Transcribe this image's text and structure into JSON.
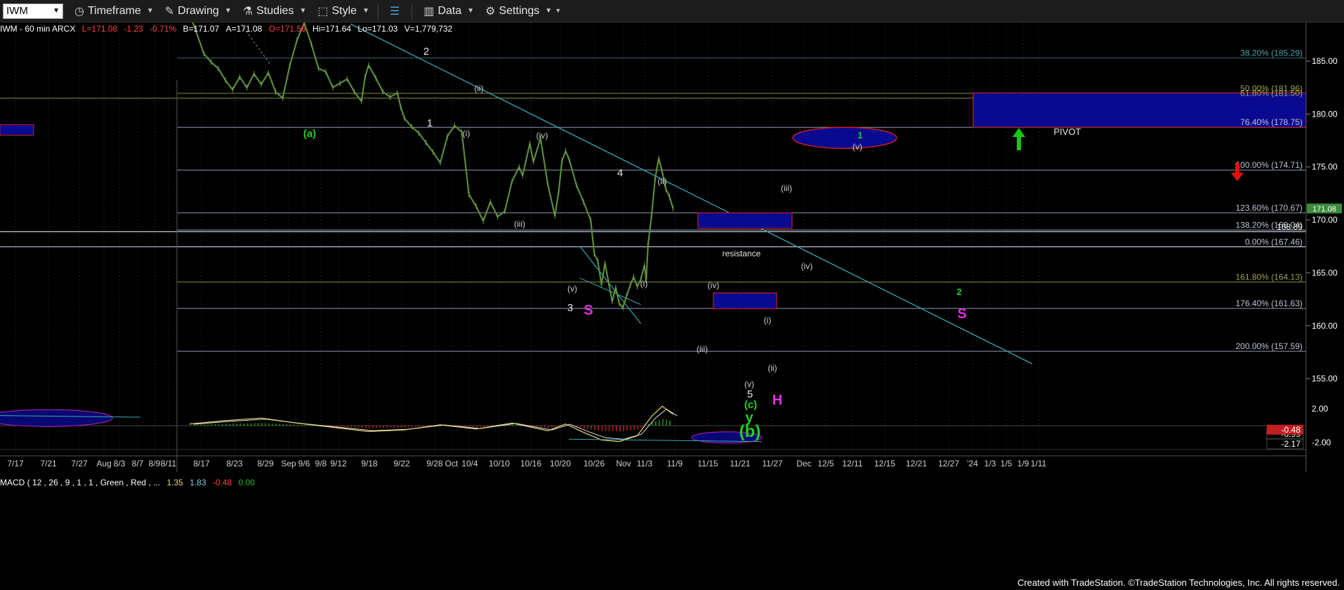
{
  "toolbar": {
    "symbol": "IWM",
    "timeframe": "Timeframe",
    "drawing": "Drawing",
    "studies": "Studies",
    "style": "Style",
    "data": "Data",
    "settings": "Settings"
  },
  "status": {
    "name": "IWM - 60 min  ARCX",
    "last": "L=171.08",
    "change": "-1.23",
    "change_pct": "-0.71%",
    "bid": "B=171.07",
    "ask": "A=171.08",
    "open": "O=171.56",
    "high": "Hi=171.64",
    "low": "Lo=171.03",
    "volume": "V=1,779,732"
  },
  "macd_status": {
    "name": "MACD ( 12 , 26 , 9 , 1 , 1 , Green , Red , ...",
    "v1": "1.35",
    "v2": "1.83",
    "v3": "-0.48",
    "v4": "0.00"
  },
  "credit": "Created with TradeStation. ©TradeStation Technologies, Inc. All rights reserved.",
  "colors": {
    "price": "#5a8a3c",
    "fib_line": "#8a9ab0",
    "trend_line": "#36a8b8",
    "box": "#0a0a90",
    "label_green": "#1ed01e",
    "label_magenta": "#e030e0",
    "pivot_arrow": "#14c814",
    "down_arrow": "#e01010",
    "macd_fast": "#e8d46a",
    "macd_slow": "#e0e0e0"
  },
  "chart_data": {
    "type": "line",
    "title": "IWM - 60 min",
    "y_axis": {
      "ticks": [
        "185.00",
        "180.00",
        "175.00",
        "170.00",
        "165.00",
        "160.00",
        "155.00"
      ],
      "ylim": [
        153.2,
        189.5
      ]
    },
    "x_axis": {
      "ticks": [
        "7/17",
        "7/21",
        "7/27",
        "Aug",
        "8/3",
        "8/7",
        "8/9",
        "8/11",
        "8/17",
        "8/23",
        "8/29",
        "Sep",
        "9/6",
        "9/8",
        "9/12",
        "9/18",
        "9/22",
        "9/28",
        "Oct",
        "10/4",
        "10/10",
        "10/16",
        "10/20",
        "10/26",
        "Nov",
        "11/3",
        "11/9",
        "11/15",
        "11/21",
        "11/27",
        "Dec",
        "12/5",
        "12/11",
        "12/15",
        "12/21",
        "12/27",
        "'24",
        "1/3",
        "1/5",
        "1/9",
        "1/11"
      ]
    },
    "last_price": "171.08",
    "level_tag": "168.89",
    "series": [
      {
        "name": "IWM",
        "points": [
          [
            0,
            189.5
          ],
          [
            8,
            185.7
          ],
          [
            12,
            184.9
          ],
          [
            16,
            184.3
          ],
          [
            20,
            183.2
          ],
          [
            24,
            182.3
          ],
          [
            28,
            183.5
          ],
          [
            32,
            182.5
          ],
          [
            36,
            183.8
          ],
          [
            40,
            182.8
          ],
          [
            44,
            183.9
          ],
          [
            48,
            182.1
          ],
          [
            52,
            181.5
          ],
          [
            56,
            184.6
          ],
          [
            60,
            187.0
          ],
          [
            64,
            188.6
          ],
          [
            68,
            186.6
          ],
          [
            72,
            184.3
          ],
          [
            76,
            184.0
          ],
          [
            80,
            182.5
          ],
          [
            84,
            182.9
          ],
          [
            88,
            183.3
          ],
          [
            92,
            182.1
          ],
          [
            96,
            181.2
          ],
          [
            98,
            183.5
          ],
          [
            100,
            184.6
          ],
          [
            104,
            183.4
          ],
          [
            108,
            182.1
          ],
          [
            112,
            181.6
          ],
          [
            116,
            182.0
          ],
          [
            118,
            180.6
          ],
          [
            120,
            179.6
          ],
          [
            124,
            178.8
          ],
          [
            128,
            178.2
          ],
          [
            132,
            177.3
          ],
          [
            136,
            176.4
          ],
          [
            140,
            175.4
          ],
          [
            144,
            177.9
          ],
          [
            148,
            178.9
          ],
          [
            152,
            178.3
          ],
          [
            156,
            172.4
          ],
          [
            160,
            171.3
          ],
          [
            164,
            169.9
          ],
          [
            168,
            171.7
          ],
          [
            172,
            170.3
          ],
          [
            176,
            170.8
          ],
          [
            180,
            173.6
          ],
          [
            184,
            175.0
          ],
          [
            186,
            174.2
          ],
          [
            190,
            177.2
          ],
          [
            192,
            175.5
          ],
          [
            196,
            177.7
          ],
          [
            200,
            173.4
          ],
          [
            204,
            170.4
          ],
          [
            206,
            172.5
          ],
          [
            208,
            175.6
          ],
          [
            210,
            176.5
          ],
          [
            212,
            175.7
          ],
          [
            216,
            173.3
          ],
          [
            220,
            171.7
          ],
          [
            224,
            170.0
          ],
          [
            226,
            166.8
          ],
          [
            228,
            166.1
          ],
          [
            230,
            163.9
          ],
          [
            232,
            165.9
          ],
          [
            234,
            164.1
          ],
          [
            236,
            162.3
          ],
          [
            238,
            163.6
          ],
          [
            240,
            162.1
          ],
          [
            242,
            161.7
          ],
          [
            244,
            162.8
          ],
          [
            246,
            163.8
          ],
          [
            248,
            164.6
          ],
          [
            250,
            163.7
          ],
          [
            252,
            164.4
          ],
          [
            254,
            165.7
          ],
          [
            255,
            164.3
          ],
          [
            256,
            167.6
          ],
          [
            258,
            170.4
          ],
          [
            260,
            173.9
          ],
          [
            262,
            175.8
          ],
          [
            264,
            174.5
          ],
          [
            266,
            172.9
          ],
          [
            268,
            172.2
          ],
          [
            270,
            171.08
          ]
        ]
      },
      {
        "name": "MACD",
        "points": [
          [
            0,
            0.2
          ],
          [
            20,
            0.6
          ],
          [
            40,
            0.9
          ],
          [
            60,
            0.3
          ],
          [
            80,
            -0.2
          ],
          [
            100,
            -0.7
          ],
          [
            120,
            -0.5
          ],
          [
            140,
            0.1
          ],
          [
            160,
            -0.4
          ],
          [
            180,
            0.3
          ],
          [
            200,
            -0.6
          ],
          [
            210,
            0.2
          ],
          [
            220,
            -0.8
          ],
          [
            230,
            -1.7
          ],
          [
            240,
            -1.9
          ],
          [
            250,
            -1.2
          ],
          [
            258,
            1.1
          ],
          [
            264,
            2.3
          ],
          [
            270,
            1.35
          ]
        ]
      }
    ],
    "fib_levels": [
      {
        "label": "38.20% (185.29)",
        "value": 185.29
      },
      {
        "label": "50.00% (181.96)",
        "value": 181.96
      },
      {
        "label": "61.80% (181.50)",
        "value": 181.5
      },
      {
        "label": "76.40% (178.75)",
        "value": 178.75
      },
      {
        "label": "100.00% (174.71)",
        "value": 174.71
      },
      {
        "label": "123.60% (170.67)",
        "value": 170.67
      },
      {
        "label": "138.20% (169.04)",
        "value": 169.04
      },
      {
        "label": "0.00% (167.46)",
        "value": 167.46
      },
      {
        "label": "161.80% (164.13)",
        "value": 164.13
      },
      {
        "label": "176.40% (161.63)",
        "value": 161.63
      },
      {
        "label": "200.00% (157.59)",
        "value": 157.59
      }
    ],
    "macd_axis": {
      "ticks": [
        "2.00",
        "-2.00"
      ],
      "ylim": [
        -3.0,
        3.0
      ],
      "tags": [
        "-0.99",
        "-0.48",
        "-2.17"
      ]
    },
    "annotations": {
      "resistance": "resistance",
      "pivot": "PIVOT",
      "white_labels": [
        "2",
        "1",
        "(i)",
        "(ii)",
        "(iv)",
        "(iii)",
        "(v)",
        "3",
        "4",
        "(ii)",
        "(i)",
        "(iv)",
        "(iii)",
        "(i)",
        "(ii)",
        "(v)",
        "5",
        "(iii)",
        "(iv)",
        "(v)"
      ],
      "green_labels": [
        "(a)",
        "(c)",
        "y",
        "(b)",
        "1",
        "2"
      ],
      "magenta_labels": [
        "S",
        "H",
        "S"
      ]
    }
  }
}
